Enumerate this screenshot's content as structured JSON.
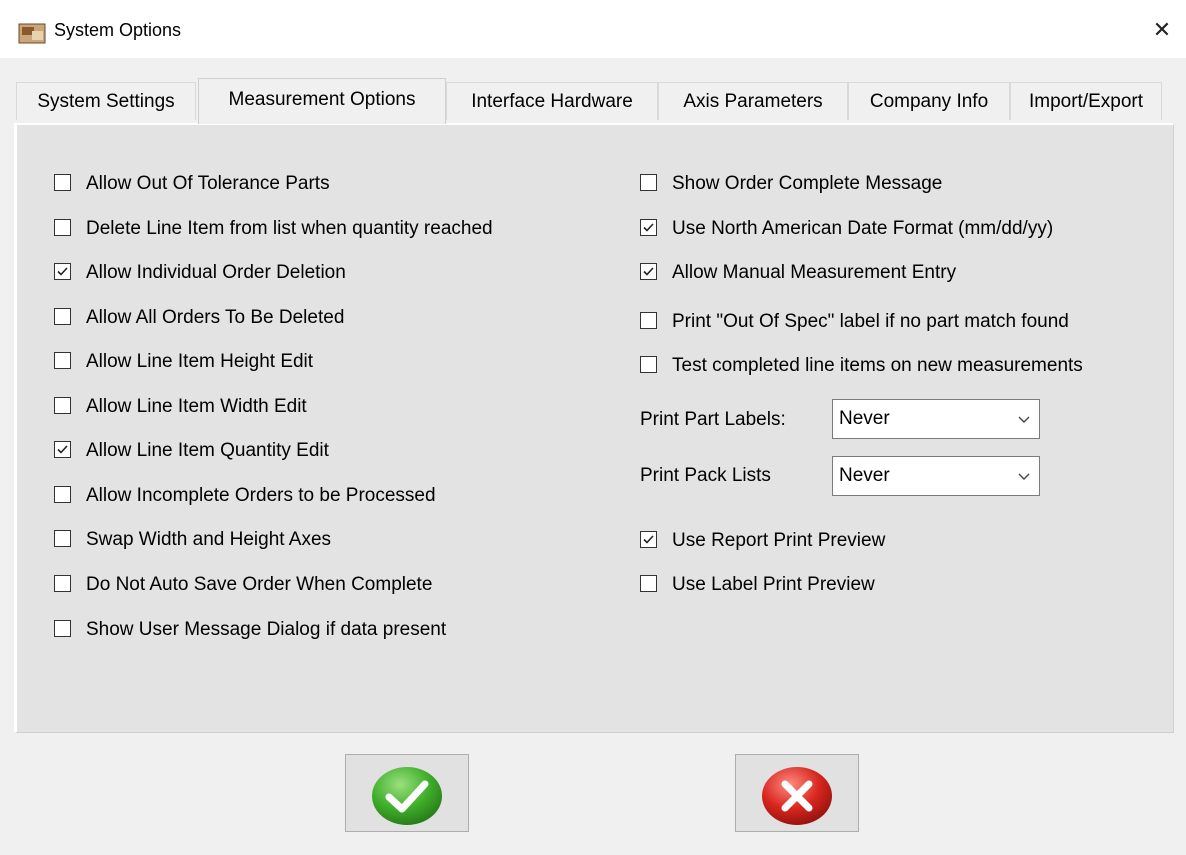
{
  "window": {
    "title": "System Options",
    "close_glyph": "✕"
  },
  "tabs": [
    {
      "label": "System Settings"
    },
    {
      "label": "Measurement Options"
    },
    {
      "label": "Interface Hardware"
    },
    {
      "label": "Axis Parameters"
    },
    {
      "label": "Company Info"
    },
    {
      "label": "Import/Export"
    }
  ],
  "active_tab": "Measurement Options",
  "left_options": [
    {
      "label": "Allow Out Of Tolerance Parts",
      "checked": false
    },
    {
      "label": "Delete Line Item from list when quantity reached",
      "checked": false
    },
    {
      "label": "Allow Individual Order Deletion",
      "checked": true
    },
    {
      "label": "Allow All Orders To Be Deleted",
      "checked": false
    },
    {
      "label": "Allow Line Item Height Edit",
      "checked": false
    },
    {
      "label": "Allow Line Item Width Edit",
      "checked": false
    },
    {
      "label": "Allow Line Item Quantity Edit",
      "checked": true
    },
    {
      "label": "Allow Incomplete Orders to be Processed",
      "checked": false
    },
    {
      "label": "Swap Width and Height Axes",
      "checked": false
    },
    {
      "label": "Do Not Auto Save Order When Complete",
      "checked": false
    },
    {
      "label": "Show User Message Dialog if data present",
      "checked": false
    }
  ],
  "right_options": [
    {
      "label": "Show Order Complete Message",
      "checked": false
    },
    {
      "label": "Use North American Date Format (mm/dd/yy)",
      "checked": true
    },
    {
      "label": "Allow Manual Measurement Entry",
      "checked": true
    },
    {
      "label": "Print \"Out Of Spec\" label if no part match found",
      "checked": false
    },
    {
      "label": "Test completed line items on new measurements",
      "checked": false
    }
  ],
  "selects": {
    "part_labels": {
      "label": "Print Part Labels:",
      "value": "Never"
    },
    "pack_lists": {
      "label": "Print Pack Lists",
      "value": "Never"
    }
  },
  "preview_options": [
    {
      "label": "Use Report Print Preview",
      "checked": true
    },
    {
      "label": "Use Label Print Preview",
      "checked": false
    }
  ],
  "buttons": {
    "ok_icon": "green-checkmark-icon",
    "cancel_icon": "red-x-icon"
  },
  "colors": {
    "ok_green": "#3fae2a",
    "cancel_red": "#d7261e",
    "panel_bg": "#e3e3e3"
  }
}
